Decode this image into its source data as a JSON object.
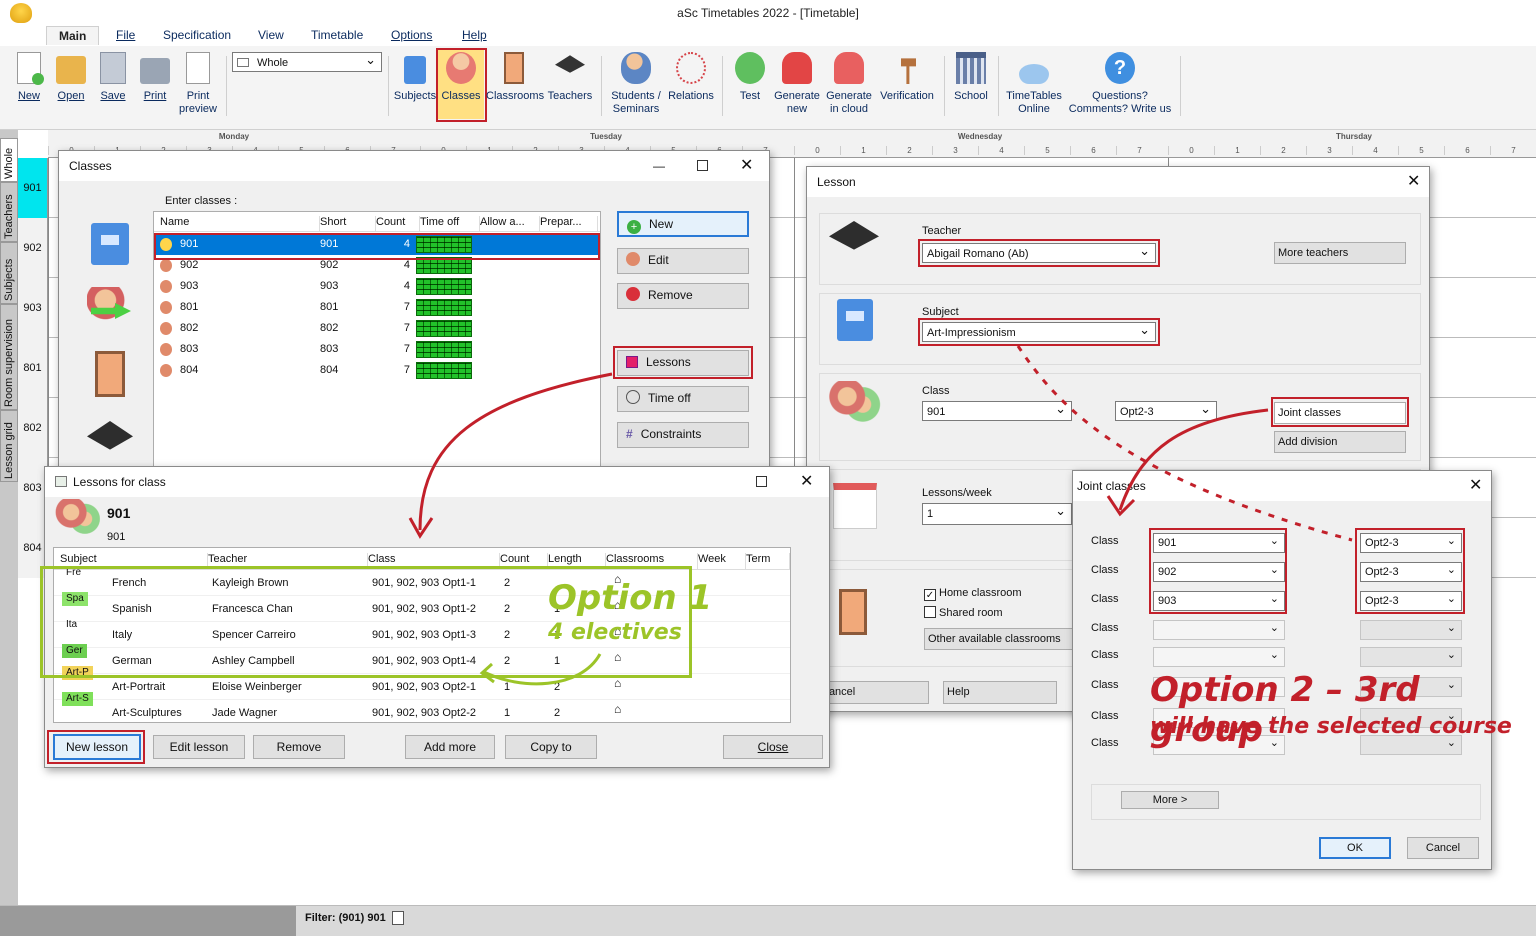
{
  "app": {
    "title": "aSc Timetables 2022  - [Timetable]"
  },
  "menu": {
    "tabs": [
      "Main",
      "File",
      "Specification",
      "View",
      "Timetable",
      "Options",
      "Help"
    ]
  },
  "ribbon": {
    "new": "New",
    "open": "Open",
    "save": "Save",
    "print": "Print",
    "print_preview_1": "Print",
    "print_preview_2": "preview",
    "view_select": "Whole",
    "subjects": "Subjects",
    "classes": "Classes",
    "classrooms": "Classrooms",
    "teachers": "Teachers",
    "students_1": "Students /",
    "students_2": "Seminars",
    "relations": "Relations",
    "test": "Test",
    "gen_new_1": "Generate",
    "gen_new_2": "new",
    "gen_cloud_1": "Generate",
    "gen_cloud_2": "in cloud",
    "verification": "Verification",
    "school": "School",
    "tt_online_1": "TimeTables",
    "tt_online_2": "Online",
    "questions_1": "Questions?",
    "questions_2": "Comments? Write us"
  },
  "grid": {
    "days": [
      "Monday",
      "Tuesday",
      "Wednesday",
      "Thursday"
    ],
    "periods": [
      "0",
      "1",
      "2",
      "3",
      "4",
      "5",
      "6",
      "7",
      "8"
    ],
    "rows": [
      "901",
      "902",
      "903",
      "801",
      "802",
      "803",
      "804"
    ],
    "side_tabs": [
      "Whole",
      "Teachers",
      "Subjects",
      "Room supervision",
      "Lesson grid"
    ]
  },
  "classes_win": {
    "title": "Classes",
    "enter": "Enter classes :",
    "cols": [
      "Name",
      "Short",
      "Count",
      "Time off",
      "Allow a...",
      "Prepar..."
    ],
    "rows": [
      {
        "name": "901",
        "short": "901",
        "count": "4"
      },
      {
        "name": "902",
        "short": "902",
        "count": "4"
      },
      {
        "name": "903",
        "short": "903",
        "count": "4"
      },
      {
        "name": "801",
        "short": "801",
        "count": "7"
      },
      {
        "name": "802",
        "short": "802",
        "count": "7"
      },
      {
        "name": "803",
        "short": "803",
        "count": "7"
      },
      {
        "name": "804",
        "short": "804",
        "count": "7"
      }
    ],
    "buttons": {
      "new": "New",
      "edit": "Edit",
      "remove": "Remove",
      "lessons": "Lessons",
      "time_off": "Time off",
      "constraints": "Constraints"
    }
  },
  "lessons_win": {
    "title": "Lessons for class",
    "class_name": "901",
    "class_short": "901",
    "cols": [
      "Subject",
      "Teacher",
      "Class",
      "Count",
      "Length",
      "Classrooms",
      "Week",
      "Term"
    ],
    "rows": [
      {
        "tag": "Fre",
        "subject": "French",
        "teacher": "Kayleigh Brown",
        "class": "901, 902, 903 Opt1-1",
        "count": "2",
        "length": "",
        "tagcolor": ""
      },
      {
        "tag": "Spa",
        "subject": "Spanish",
        "teacher": "Francesca Chan",
        "class": "901, 902, 903 Opt1-2",
        "count": "2",
        "length": "1",
        "tagcolor": "#8de36a"
      },
      {
        "tag": "Ita",
        "subject": "Italy",
        "teacher": "Spencer Carreiro",
        "class": "901, 902, 903 Opt1-3",
        "count": "2",
        "length": "1",
        "tagcolor": ""
      },
      {
        "tag": "Ger",
        "subject": "German",
        "teacher": "Ashley Campbell",
        "class": "901, 902, 903 Opt1-4",
        "count": "2",
        "length": "1",
        "tagcolor": "#6ccf50"
      },
      {
        "tag": "Art-P",
        "subject": "Art-Portrait",
        "teacher": "Eloise Weinberger",
        "class": "901, 902, 903 Opt2-1",
        "count": "1",
        "length": "2",
        "tagcolor": "#f2d35a"
      },
      {
        "tag": "Art-S",
        "subject": "Art-Sculptures",
        "teacher": "Jade Wagner",
        "class": "901, 902, 903 Opt2-2",
        "count": "1",
        "length": "2",
        "tagcolor": "#7fe05a"
      }
    ],
    "buttons": {
      "new": "New lesson",
      "edit": "Edit lesson",
      "remove": "Remove",
      "add_more": "Add more",
      "copy_to": "Copy to",
      "close": "Close"
    }
  },
  "lesson_win": {
    "title": "Lesson",
    "teacher_label": "Teacher",
    "teacher": "Abigail Romano (Ab)",
    "more_teachers": "More teachers",
    "subject_label": "Subject",
    "subject": "Art-Impressionism",
    "class_label": "Class",
    "class": "901",
    "group": "Opt2-3",
    "joint": "Joint classes",
    "add_division": "Add division",
    "lpw_label": "Lessons/week",
    "lpw": "1",
    "home": "Home classroom",
    "shared": "Shared room",
    "other": "Other available classrooms",
    "cancel": "Cancel",
    "help": "Help"
  },
  "joint_win": {
    "title": "Joint classes",
    "class_label": "Class",
    "classes": [
      "901",
      "902",
      "903",
      "",
      "",
      "",
      "",
      ""
    ],
    "groups": [
      "Opt2-3",
      "Opt2-3",
      "Opt2-3",
      "",
      "",
      "",
      "",
      ""
    ],
    "more": "More >",
    "ok": "OK",
    "cancel": "Cancel"
  },
  "annotations": {
    "opt1_a": "Option 1",
    "opt1_b": "4 electives",
    "opt2_a": "Option 2 – 3rd group",
    "opt2_b": "will have the selected course"
  },
  "status": {
    "filter": "Filter: (901) 901"
  },
  "colors": {
    "accent_red": "#c2202a",
    "annot_green": "#9cc428",
    "selection": "#0078d7",
    "timeoff_green": "#22c22a"
  }
}
